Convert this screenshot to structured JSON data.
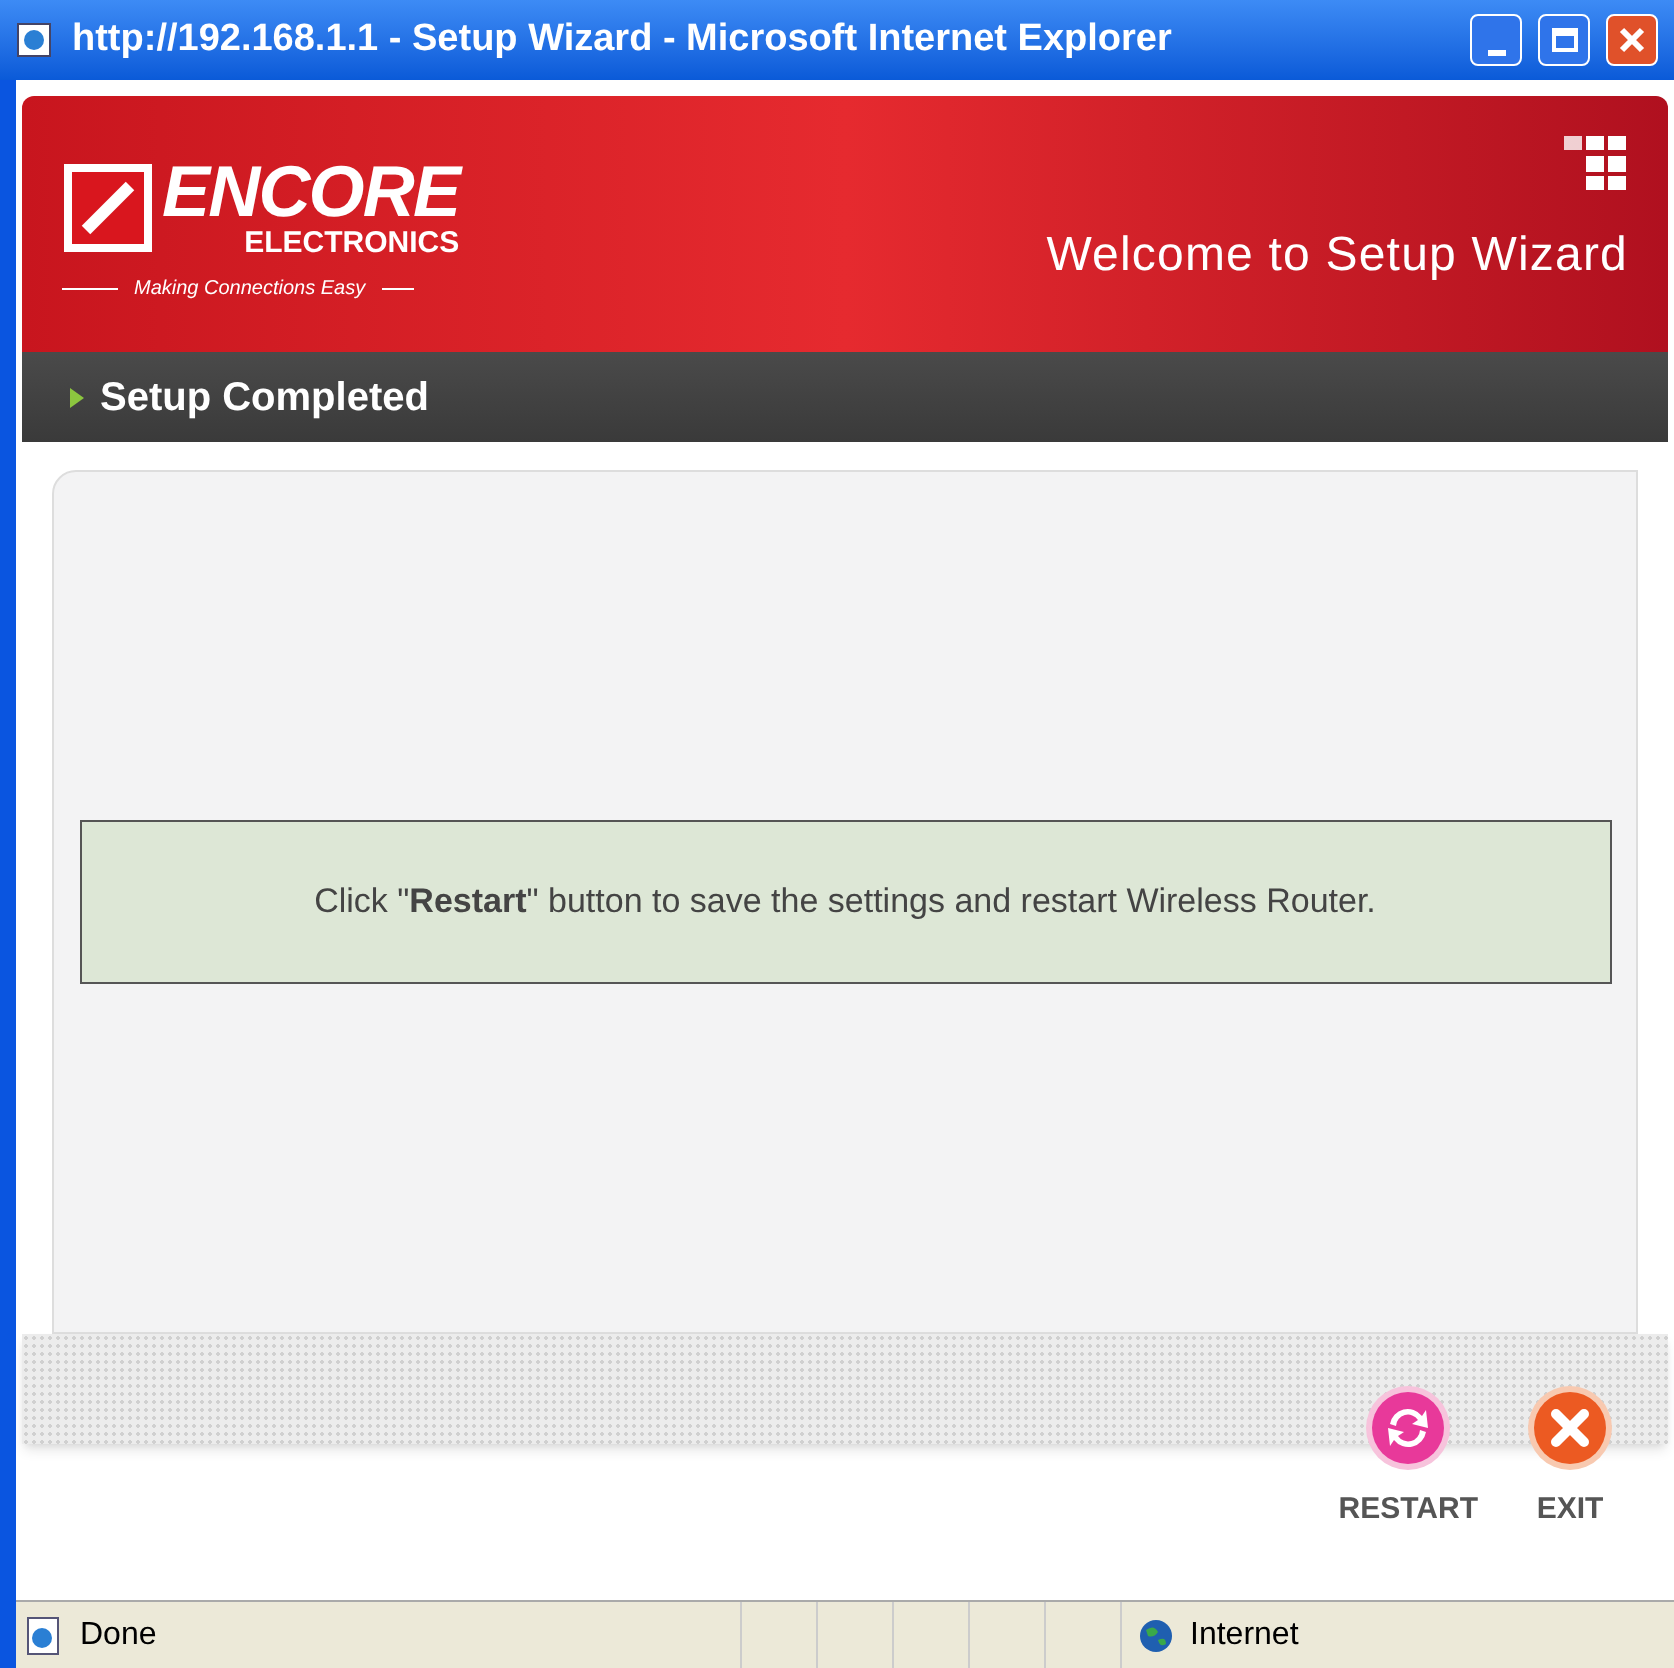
{
  "window": {
    "title": "http://192.168.1.1 - Setup Wizard - Microsoft Internet Explorer"
  },
  "header": {
    "logo_main": "ENCORE",
    "logo_sub": "ELECTRONICS",
    "tagline": "Making Connections Easy",
    "title": "Welcome to Setup Wizard"
  },
  "section": {
    "title": "Setup Completed"
  },
  "message": "Click \"**Restart**\" button to save the settings and restart Wireless Router.",
  "buttons": [
    {
      "kind": "restart",
      "label": "RESTART"
    },
    {
      "kind": "exit",
      "label": "EXIT"
    }
  ],
  "status_bar": {
    "status": "Done",
    "zone": "Internet"
  }
}
